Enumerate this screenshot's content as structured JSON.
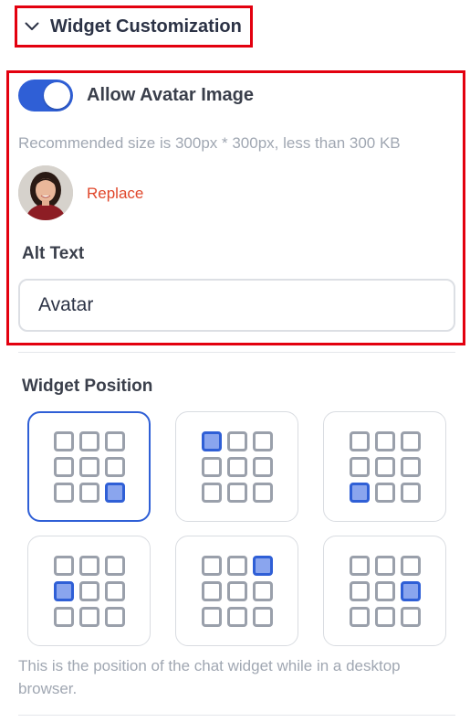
{
  "section": {
    "title": "Widget Customization",
    "chevron_icon": "chevron-down-icon"
  },
  "avatar": {
    "toggle_label": "Allow Avatar Image",
    "toggle_on": true,
    "size_hint": "Recommended size is 300px * 300px, less than 300 KB",
    "replace_label": "Replace",
    "alt_text_label": "Alt Text",
    "alt_text_value": "Avatar"
  },
  "position": {
    "label": "Widget Position",
    "note": "This is the position of the chat widget while in a desktop browser.",
    "selected_index": 0,
    "options": [
      {
        "name": "bottom-right",
        "active_cell": 8
      },
      {
        "name": "top-left",
        "active_cell": 0
      },
      {
        "name": "bottom-left",
        "active_cell": 6
      },
      {
        "name": "middle-left",
        "active_cell": 3
      },
      {
        "name": "top-right",
        "active_cell": 2
      },
      {
        "name": "middle-right",
        "active_cell": 5
      }
    ]
  },
  "colors": {
    "accent": "#2f5fd6",
    "highlight_border": "#e3000f",
    "link": "#e0472b",
    "muted_text": "#a0a7b2"
  }
}
